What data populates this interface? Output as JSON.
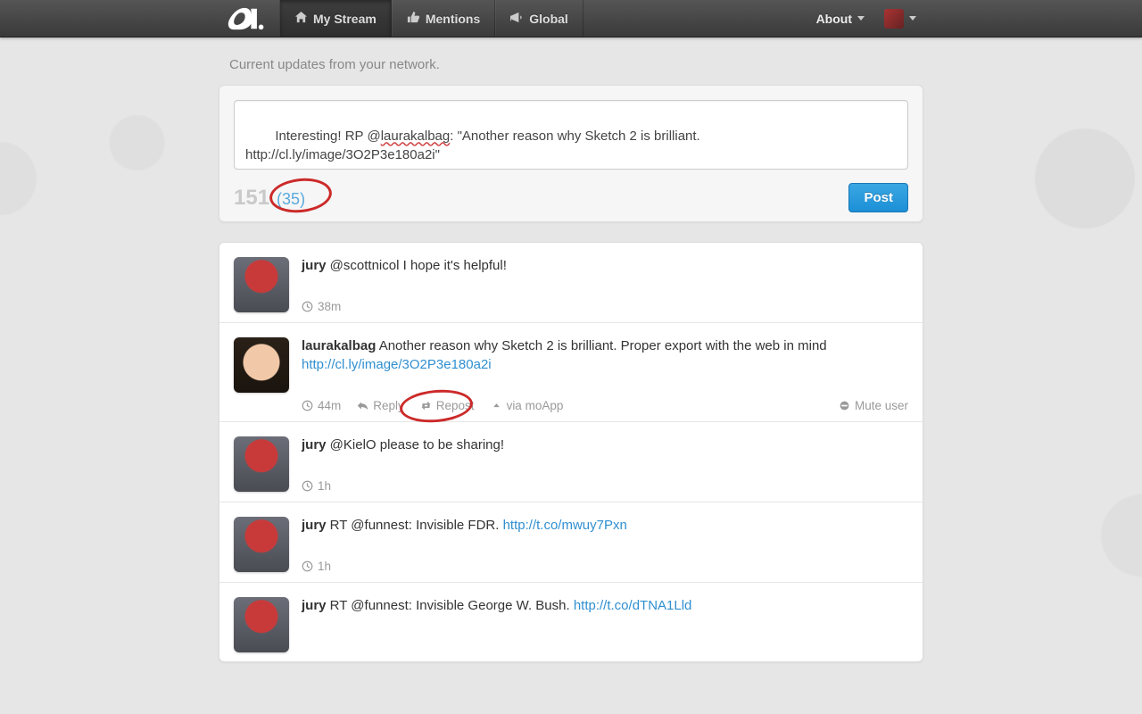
{
  "nav": {
    "my_stream": "My Stream",
    "mentions": "Mentions",
    "global": "Global",
    "about": "About"
  },
  "subtitle": "Current updates from your network.",
  "composer": {
    "text_pre": "Interesting! RP @",
    "text_handle": "laurakalbag",
    "text_post": ": \"Another reason why Sketch 2 is brilliant. http://cl.ly/image/3O2P3e180a2i\"",
    "count_main": "151",
    "count_quote": "(35)",
    "post_label": "Post"
  },
  "actions": {
    "reply": "Reply",
    "repost": "Repost",
    "via": "via moApp",
    "mute": "Mute user"
  },
  "posts": [
    {
      "user": "jury",
      "avatarClass": "av-robot",
      "body": "@scottnicol I hope it's helpful!",
      "link": "",
      "time": "38m",
      "showActions": false
    },
    {
      "user": "laurakalbag",
      "avatarClass": "av-person",
      "body": "Another reason why Sketch 2 is brilliant. Proper export with the web in mind",
      "link": "http://cl.ly/image/3O2P3e180a2i",
      "time": "44m",
      "showActions": true
    },
    {
      "user": "jury",
      "avatarClass": "av-robot",
      "body": "@KielO please to be sharing!",
      "link": "",
      "time": "1h",
      "showActions": false
    },
    {
      "user": "jury",
      "avatarClass": "av-robot",
      "body": "RT @funnest: Invisible FDR.",
      "link": "http://t.co/mwuy7Pxn",
      "time": "1h",
      "showActions": false
    },
    {
      "user": "jury",
      "avatarClass": "av-robot",
      "body": "RT @funnest: Invisible George W. Bush.",
      "link": "http://t.co/dTNA1Lld",
      "time": "",
      "showActions": false
    }
  ]
}
